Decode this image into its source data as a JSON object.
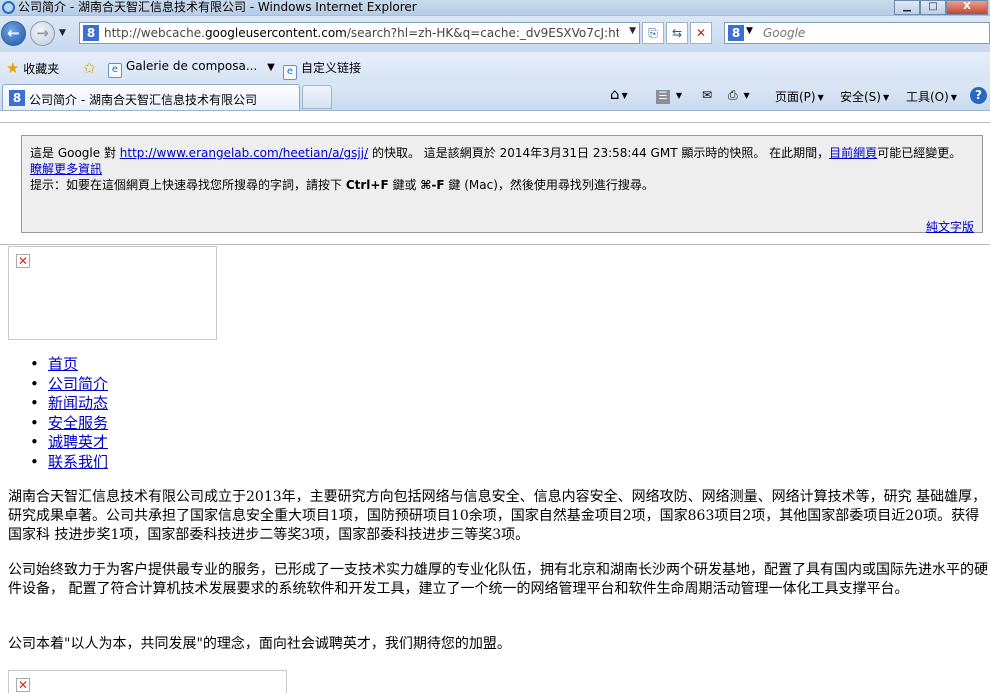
{
  "window": {
    "title": "公司简介 - 湖南合天智汇信息技术有限公司 - Windows Internet Explorer",
    "minimize_icon": "minimize-icon",
    "maximize_icon": "maximize-icon",
    "close_label": "X"
  },
  "addressbar": {
    "url_prefix": "http://webcache.",
    "url_host": "googleusercontent.com",
    "url_rest": "/search?hl=zh-HK&q=cache:_dv9ESXVo7cJ:http:/",
    "favicon": "8"
  },
  "search": {
    "placeholder": "Google",
    "favicon": "8"
  },
  "favorites": {
    "favorites_label": "收藏夹",
    "items": [
      {
        "label": "Galerie de composa..."
      },
      {
        "label": "自定义链接"
      }
    ]
  },
  "tab": {
    "label": "公司简介 - 湖南合天智汇信息技术有限公司",
    "favicon": "8"
  },
  "commands": {
    "page": "页面(P)",
    "safety": "安全(S)",
    "tools": "工具(O)",
    "help": "?"
  },
  "cache_notice": {
    "text_1": "這是 Google 對 ",
    "link_url": "http://www.erangelab.com/heetian/a/gsjj/",
    "text_2": " 的快取。 這是該網頁於 2014年3月31日 23:58:44 GMT 顯示時的快照。 在此期間，",
    "current_link": "目前網頁",
    "text_3": "可能已經變更。 ",
    "more_link": "瞭解更多資訊",
    "tip_prefix": "提示：如要在這個網頁上快速尋找您所搜尋的字詞，請按下 ",
    "tip_key1": "Ctrl+F",
    "tip_mid": " 鍵或 ",
    "tip_key2": "⌘-F",
    "tip_suffix": " 鍵 (Mac)，然後使用尋找列進行搜尋。",
    "plain_text_link": "純文字版"
  },
  "nav": [
    {
      "label": "首页"
    },
    {
      "label": "公司简介"
    },
    {
      "label": "新闻动态"
    },
    {
      "label": "安全服务"
    },
    {
      "label": "诚聘英才"
    },
    {
      "label": "联系我们"
    }
  ],
  "paragraphs": [
    "湖南合天智汇信息技术有限公司成立于2013年，主要研究方向包括网络与信息安全、信息内容安全、网络攻防、网络测量、网络计算技术等，研究 基础雄厚，研究成果卓著。公司共承担了国家信息安全重大项目1项，国防预研项目10余项，国家自然基金项目2项，国家863项目2项，其他国家部委项目近20项。获得国家科 技进步奖1项，国家部委科技进步二等奖3项，国家部委科技进步三等奖3项。",
    "公司始终致力于为客户提供最专业的服务，已形成了一支技术实力雄厚的专业化队伍，拥有北京和湖南长沙两个研发基地，配置了具有国内或国际先进水平的硬件设备， 配置了符合计算机技术发展要求的系统软件和开发工具，建立了一个统一的网络管理平台和软件生命周期活动管理一体化工具支撑平台。",
    "公司本着\"以人为本，共同发展\"的理念，面向社会诚聘英才，我们期待您的加盟。"
  ],
  "broken_image_glyph": "✕"
}
